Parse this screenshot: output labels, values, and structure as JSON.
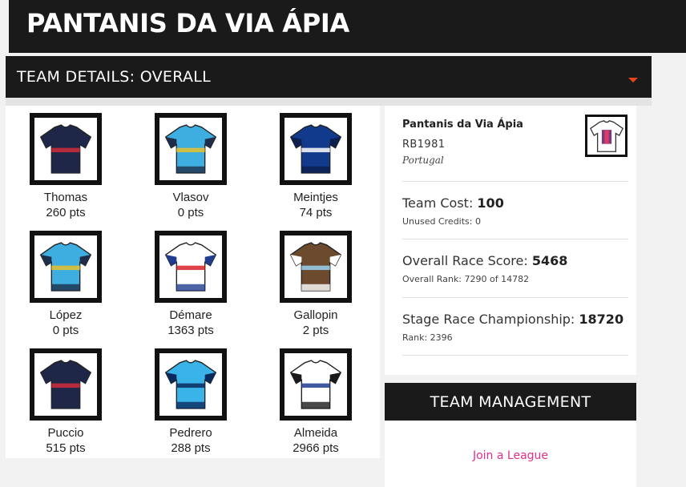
{
  "header": {
    "title": "PANTANIS DA VIA ÁPIA"
  },
  "details": {
    "label": "TEAM DETAILS: OVERALL"
  },
  "riders": [
    {
      "name": "Thomas",
      "pts": "260 pts",
      "body": "#1f2748",
      "accent": "#d12d3a",
      "trim": "#1f2748"
    },
    {
      "name": "Vlasov",
      "pts": "0 pts",
      "body": "#3eaee0",
      "accent": "#e8c32a",
      "trim": "#1e2e4a"
    },
    {
      "name": "Meintjes",
      "pts": "74 pts",
      "body": "#123a8c",
      "accent": "#ffffff",
      "trim": "#0d1f4f"
    },
    {
      "name": "López",
      "pts": "0 pts",
      "body": "#3eaee0",
      "accent": "#e8c32a",
      "trim": "#1e2e4a"
    },
    {
      "name": "Démare",
      "pts": "1363 pts",
      "body": "#ffffff",
      "accent": "#d8222a",
      "trim": "#1f3c8f"
    },
    {
      "name": "Gallopin",
      "pts": "2 pts",
      "body": "#6b4a2e",
      "accent": "#9ad1ee",
      "trim": "#ffffff"
    },
    {
      "name": "Puccio",
      "pts": "515 pts",
      "body": "#1f2748",
      "accent": "#d12d3a",
      "trim": "#1f2748"
    },
    {
      "name": "Pedrero",
      "pts": "288 pts",
      "body": "#39b3e8",
      "accent": "#0a2a5e",
      "trim": "#0a2a5e"
    },
    {
      "name": "Almeida",
      "pts": "2966 pts",
      "body": "#ffffff",
      "accent": "#1f3c8f",
      "trim": "#1a1a1a"
    }
  ],
  "team": {
    "name": "Pantanis da Via Ápia",
    "user": "RB1981",
    "country": "Portugal",
    "cost_label": "Team Cost: ",
    "cost_value": "100",
    "credits": "Unused Credits: 0",
    "score_label": "Overall Race Score: ",
    "score_value": "5468",
    "score_rank": "Overall Rank: 7290 of 14782",
    "stage_label": "Stage Race Championship: ",
    "stage_value": "18720",
    "stage_rank": "Rank: 2396"
  },
  "management": {
    "title": "TEAM MANAGEMENT",
    "link": "Join a League"
  },
  "colors": {
    "bar": "#1a1a1a",
    "caret": "#e8441a",
    "link": "#e0308a"
  }
}
